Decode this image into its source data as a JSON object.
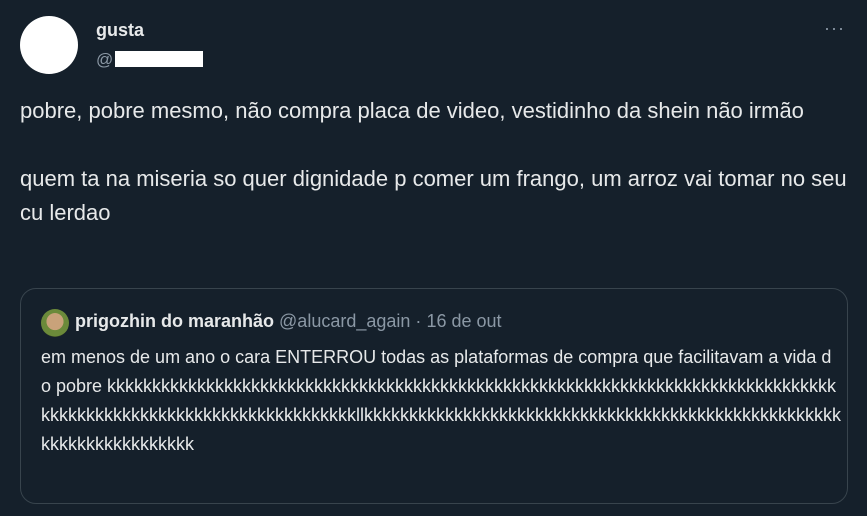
{
  "tweet": {
    "display_name": "gusta",
    "handle_prefix": "@",
    "text_1": "pobre, pobre mesmo, não compra placa de video, vestidinho da shein não irmão",
    "text_2": "quem ta na miseria so quer dignidade p comer um frango, um arroz vai tomar no seu cu lerdao",
    "more_label": "···"
  },
  "quote": {
    "display_name": "prigozhin do maranhão",
    "handle": "@alucard_again",
    "separator": "·",
    "date": "16 de out",
    "text": "em menos de um ano o cara ENTERROU todas as plataformas de compra que facilitavam a vida do pobre kkkkkkkkkkkkkkkkkkkkkkkkkkkkkkkkkkkkkkkkkkkkkkkkkkkkkkkkkkkkkkkkkkkkkkkkkkkkkkkkkkkkkkkkkkkkkkkkkkkkkkkkkkkkkkkkkkkkllkkkkkkkkkkkkkkkkkkkkkkkkkkkkkkkkkkkkkkkkkkkkkkkkkkkkkkkkkkkkkkkkkkkkkk"
  },
  "colors": {
    "background": "#15202b",
    "text": "#e7e9ea",
    "secondary_text": "#8b98a5",
    "border": "#38444d"
  }
}
